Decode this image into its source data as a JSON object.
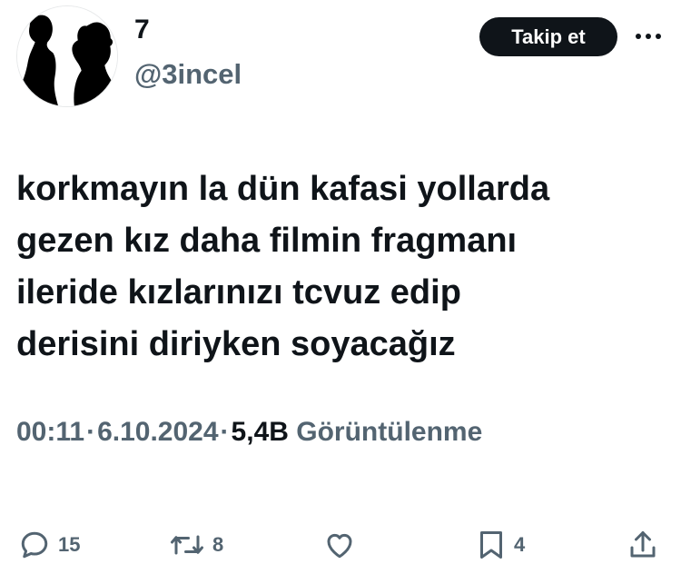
{
  "author": {
    "display_name": "7",
    "handle": "@3incel"
  },
  "header": {
    "follow_label": "Takip et",
    "more_icon": "more-horizontal-icon"
  },
  "tweet": {
    "lines": [
      "korkmayın la dün kafasi yollarda",
      "gezen kız daha filmin fragmanı",
      "ileride kızlarınızı tcvuz edip",
      "derisini diriyken soyacağız"
    ]
  },
  "meta": {
    "time": "00:11",
    "date": "6.10.2024",
    "views_count": "5,4B",
    "views_label": "Görüntülenme"
  },
  "actions": {
    "replies": "15",
    "reposts": "8",
    "bookmarks": "4"
  },
  "colors": {
    "text": "#0f1419",
    "muted": "#536471",
    "button_bg": "#0f1419"
  }
}
